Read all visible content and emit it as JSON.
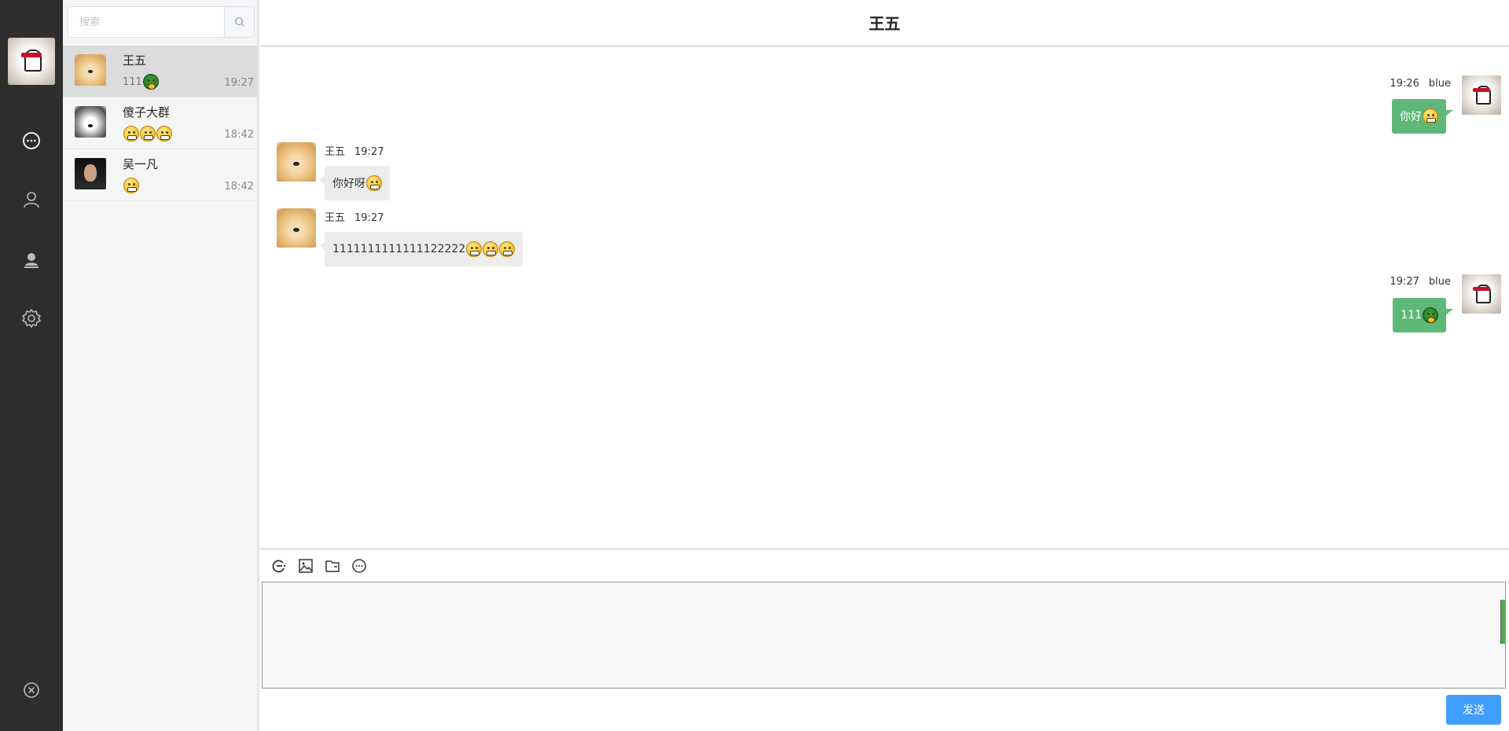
{
  "nav": {
    "items": [
      {
        "icon": "chat-icon"
      },
      {
        "icon": "user-icon"
      },
      {
        "icon": "contacts-icon"
      },
      {
        "icon": "gear-icon"
      }
    ],
    "bottom_icon": "close-circle-icon"
  },
  "search": {
    "placeholder": "搜索"
  },
  "contacts": [
    {
      "name": "王五",
      "preview": "111",
      "preview_emojis": [
        "turtle"
      ],
      "time": "19:27",
      "active": true
    },
    {
      "name": "傻子大群",
      "preview": "",
      "preview_emojis": [
        "face",
        "face",
        "face"
      ],
      "time": "18:42",
      "active": false
    },
    {
      "name": "吴一凡",
      "preview": "",
      "preview_emojis": [
        "face"
      ],
      "time": "18:42",
      "active": false
    }
  ],
  "chat": {
    "title": "王五",
    "messages": [
      {
        "side": "right",
        "sender": "blue",
        "time": "19:26",
        "text": "你好",
        "emojis": [
          "face"
        ]
      },
      {
        "side": "left",
        "sender": "王五",
        "time": "19:27",
        "text": "你好呀",
        "emojis": [
          "face"
        ]
      },
      {
        "side": "left",
        "sender": "王五",
        "time": "19:27",
        "text": "1111111111111122222",
        "emojis": [
          "face",
          "face",
          "face"
        ]
      },
      {
        "side": "right",
        "sender": "blue",
        "time": "19:27",
        "text": "111",
        "emojis": [
          "turtle"
        ]
      }
    ]
  },
  "toolbar": {
    "tools": [
      "emoji-icon",
      "image-icon",
      "folder-icon",
      "chat-history-icon"
    ]
  },
  "editor": {
    "value": ""
  },
  "send_label": "发送",
  "colors": {
    "nav_bg": "#2e2e2e",
    "list_bg": "#f5f5f5",
    "active_contact": "#dcdcdc",
    "bubble_right": "#5fb878",
    "bubble_left": "#ececec",
    "send_button": "#409eff"
  }
}
